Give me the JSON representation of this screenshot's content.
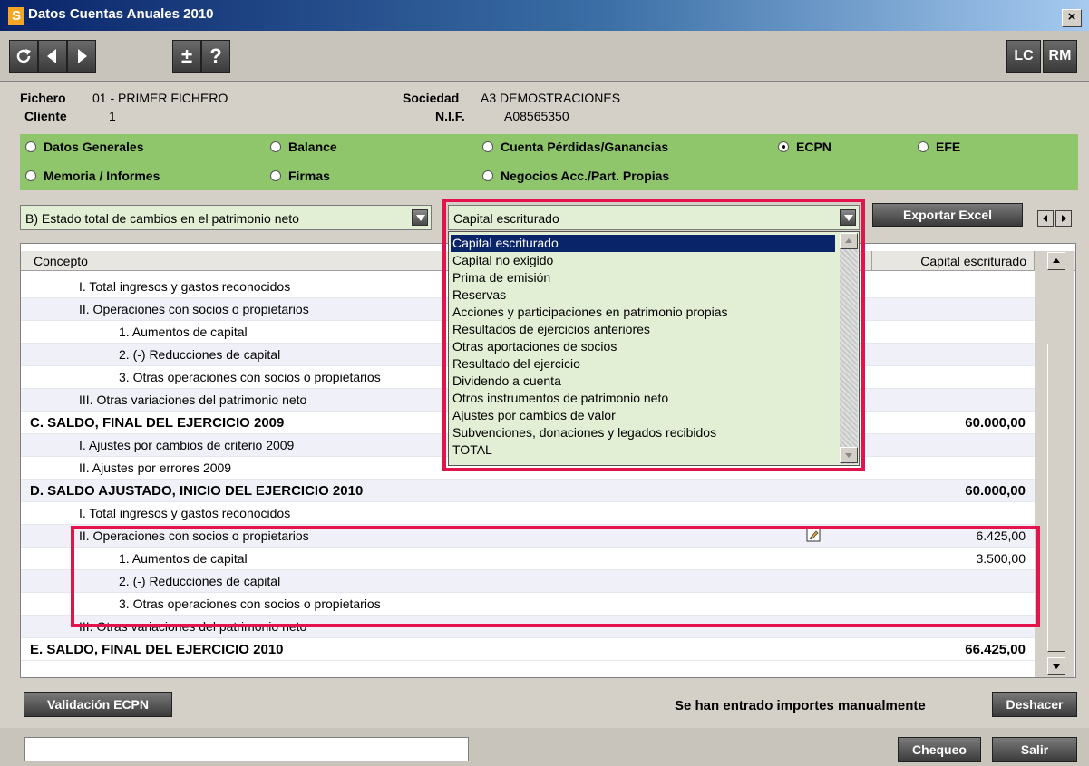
{
  "window": {
    "title": "Datos Cuentas Anuales 2010",
    "app_icon": "S",
    "close": "×"
  },
  "toolbar": {
    "plusminus": "±",
    "help": "?",
    "lc": "LC",
    "rm": "RM"
  },
  "info": {
    "fichero_label": "Fichero",
    "fichero_value": "01 - PRIMER FICHERO",
    "cliente_label": "Cliente",
    "cliente_value": "1",
    "sociedad_label": "Sociedad",
    "sociedad_value": "A3 DEMOSTRACIONES",
    "nif_label": "N.I.F.",
    "nif_value": "A08565350"
  },
  "sections": [
    {
      "label": "Datos Generales",
      "selected": false
    },
    {
      "label": "Balance",
      "selected": false
    },
    {
      "label": "Cuenta Pérdidas/Ganancias",
      "selected": false
    },
    {
      "label": "ECPN",
      "selected": true
    },
    {
      "label": "EFE",
      "selected": false
    },
    {
      "label": "Memoria / Informes",
      "selected": false
    },
    {
      "label": "Firmas",
      "selected": false
    },
    {
      "label": "Negocios Acc./Part. Propias",
      "selected": false
    }
  ],
  "controls": {
    "statement_select": "B) Estado total de cambios en el patrimonio neto",
    "column_select": "Capital escriturado",
    "export_button": "Exportar Excel"
  },
  "dropdown_options": [
    "Capital escriturado",
    "Capital no exigido",
    "Prima de emisión",
    "Reservas",
    "Acciones y participaciones en patrimonio propias",
    "Resultados de ejercicios anteriores",
    "Otras aportaciones de socios",
    "Resultado del ejercicio",
    "Dividendo a cuenta",
    "Otros instrumentos de patrimonio neto",
    "Ajustes por cambios de valor",
    "Subvenciones, donaciones y legados recibidos",
    "TOTAL"
  ],
  "table": {
    "col_concepto": "Concepto",
    "col_value": "Capital escriturado",
    "rows": [
      {
        "label": "I. Total ingresos y gastos reconocidos",
        "value": ""
      },
      {
        "label": "II. Operaciones con socios o propietarios",
        "value": ""
      },
      {
        "label": "1. Aumentos de capital",
        "value": ""
      },
      {
        "label": "2. (-) Reducciones de capital",
        "value": ""
      },
      {
        "label": "3. Otras operaciones con socios o propietarios",
        "value": ""
      },
      {
        "label": "III. Otras variaciones del patrimonio neto",
        "value": ""
      },
      {
        "label": "C. SALDO, FINAL DEL EJERCICIO 2009",
        "value": "60.000,00"
      },
      {
        "label": "I. Ajustes por cambios de criterio 2009",
        "value": ""
      },
      {
        "label": "II. Ajustes por errores 2009",
        "value": ""
      },
      {
        "label": "D. SALDO AJUSTADO, INICIO DEL EJERCICIO 2010",
        "value": "60.000,00"
      },
      {
        "label": "I. Total ingresos y gastos reconocidos",
        "value": ""
      },
      {
        "label": "II. Operaciones con socios o propietarios",
        "value": "6.425,00"
      },
      {
        "label": "1. Aumentos de capital",
        "value": "3.500,00"
      },
      {
        "label": "2. (-) Reducciones de capital",
        "value": ""
      },
      {
        "label": "3. Otras operaciones con socios o propietarios",
        "value": ""
      },
      {
        "label": "III. Otras variaciones del patrimonio neto",
        "value": ""
      },
      {
        "label": "E. SALDO, FINAL DEL EJERCICIO 2010",
        "value": "66.425,00"
      }
    ]
  },
  "bottom": {
    "validation_button": "Validación ECPN",
    "manual_notice": "Se han entrado importes manualmente",
    "undo_button": "Deshacer",
    "check_button": "Chequeo",
    "exit_button": "Salir",
    "status_text": ""
  }
}
